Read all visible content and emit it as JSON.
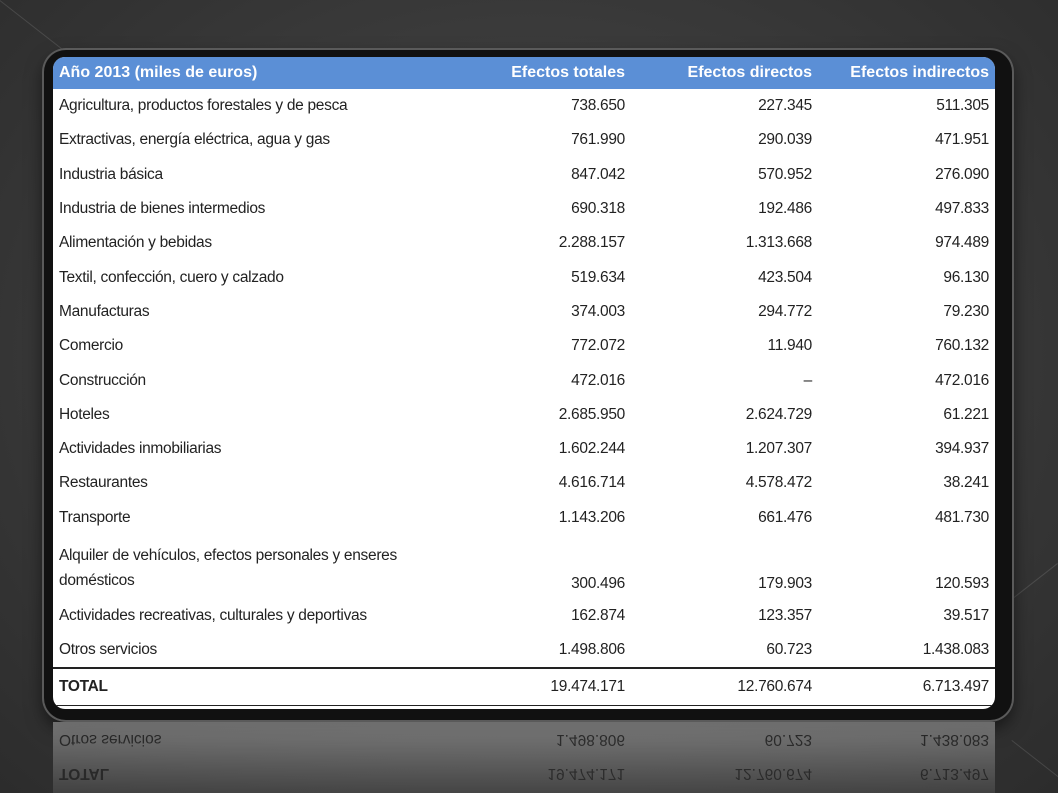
{
  "table": {
    "headers": [
      "Año 2013 (miles de euros)",
      "Efectos totales",
      "Efectos directos",
      "Efectos indirectos"
    ],
    "rows": [
      [
        "Agricultura, productos forestales y de pesca",
        "738.650",
        "227.345",
        "511.305"
      ],
      [
        "Extractivas, energía eléctrica, agua y gas",
        "761.990",
        "290.039",
        "471.951"
      ],
      [
        "Industria  básica",
        "847.042",
        "570.952",
        "276.090"
      ],
      [
        "Industria de bienes intermedios",
        "690.318",
        "192.486",
        "497.833"
      ],
      [
        "Alimentación y bebidas",
        "2.288.157",
        "1.313.668",
        "974.489"
      ],
      [
        "Textil, confección, cuero y calzado",
        "519.634",
        "423.504",
        "96.130"
      ],
      [
        "Manufacturas",
        "374.003",
        "294.772",
        "79.230"
      ],
      [
        "Comercio",
        "772.072",
        "11.940",
        "760.132"
      ],
      [
        "Construcción",
        "472.016",
        "–",
        "472.016"
      ],
      [
        "Hoteles",
        "2.685.950",
        "2.624.729",
        "61.221"
      ],
      [
        "Actividades inmobiliarias",
        "1.602.244",
        "1.207.307",
        "394.937"
      ],
      [
        "Restaurantes",
        "4.616.714",
        "4.578.472",
        "38.241"
      ],
      [
        "Transporte",
        "1.143.206",
        "661.476",
        "481.730"
      ],
      [
        "Alquiler de vehículos, efectos personales   y enseres domésticos",
        "300.496",
        "179.903",
        "120.593"
      ],
      [
        "Actividades recreativas, culturales y deportivas",
        "162.874",
        "123.357",
        "39.517"
      ],
      [
        "Otros servicios",
        "1.498.806",
        "60.723",
        "1.438.083"
      ]
    ],
    "total": [
      "TOTAL",
      "19.474.171",
      "12.760.674",
      "6.713.497"
    ]
  }
}
